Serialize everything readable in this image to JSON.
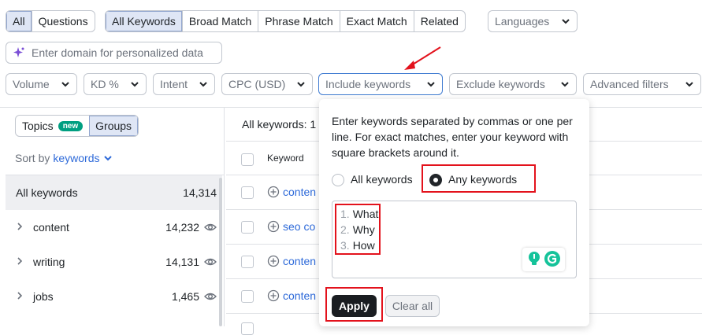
{
  "row1": {
    "seg1": [
      "All",
      "Questions"
    ],
    "seg2": [
      "All Keywords",
      "Broad Match",
      "Phrase Match",
      "Exact Match",
      "Related"
    ],
    "languages": "Languages"
  },
  "domain_placeholder": "Enter domain for personalized data",
  "filters": [
    "Volume",
    "KD %",
    "Intent",
    "CPC (USD)",
    "Include keywords",
    "Exclude keywords",
    "Advanced filters"
  ],
  "left": {
    "topics": "Topics",
    "new_badge": "new",
    "groups": "Groups",
    "sort_prefix": "Sort by",
    "sort_field": "keywords",
    "rows": [
      {
        "name": "All keywords",
        "count": "14,314"
      },
      {
        "name": "content",
        "count": "14,232"
      },
      {
        "name": "writing",
        "count": "14,131"
      },
      {
        "name": "jobs",
        "count": "1,465"
      }
    ]
  },
  "table": {
    "summary": "All keywords: 1",
    "header_keyword": "Keyword",
    "rows": [
      "conten",
      "seo co",
      "conten",
      "conten"
    ]
  },
  "popup": {
    "description": "Enter keywords separated by commas or one per line. For exact matches, enter your keyword with square brackets around it.",
    "radio_all": "All keywords",
    "radio_any": "Any keywords",
    "keywords": [
      {
        "num": "1.",
        "text": "What"
      },
      {
        "num": "2.",
        "text": "Why"
      },
      {
        "num": "3.",
        "text": "How"
      }
    ],
    "apply": "Apply",
    "clear": "Clear all"
  },
  "colors": {
    "accent": "#2e6ad9",
    "annotation": "#e3121c",
    "badge": "#009f81"
  }
}
